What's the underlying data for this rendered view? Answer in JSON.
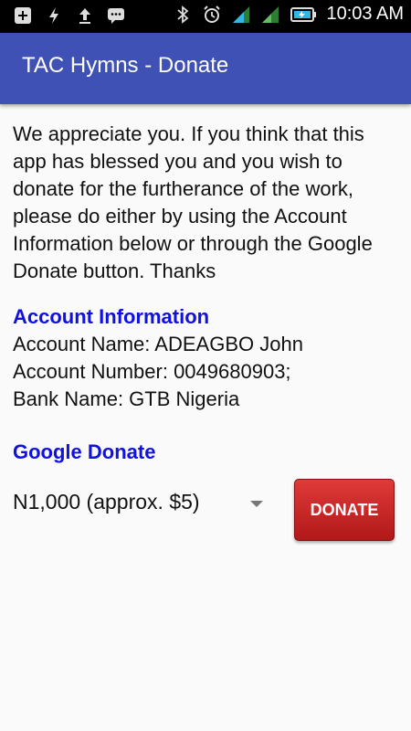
{
  "status_bar": {
    "time": "10:03 AM",
    "icons": [
      "add-box-icon",
      "flash-icon",
      "upload-icon",
      "chat-icon",
      "bluetooth-icon",
      "alarm-icon",
      "signal-icon",
      "signal-2-icon",
      "battery-icon"
    ]
  },
  "app_bar": {
    "title": "TAC Hymns - Donate",
    "color": "#3f51b5"
  },
  "content": {
    "intro": "We appreciate you. If you think that this app has blessed you and you wish to donate for the furtherance of the work, please do either by using the Account Information below or through the Google Donate button. Thanks",
    "account_heading": "Account Information",
    "account_name": "Account Name: ADEAGBO John",
    "account_number": "Account Number: 0049680903;",
    "bank_name": "Bank Name: GTB Nigeria",
    "google_heading": "Google Donate",
    "amount_selected": "N1,000 (approx. $5)",
    "donate_label": "DONATE",
    "heading_color": "#1010e0",
    "button_color": "#c62828"
  }
}
